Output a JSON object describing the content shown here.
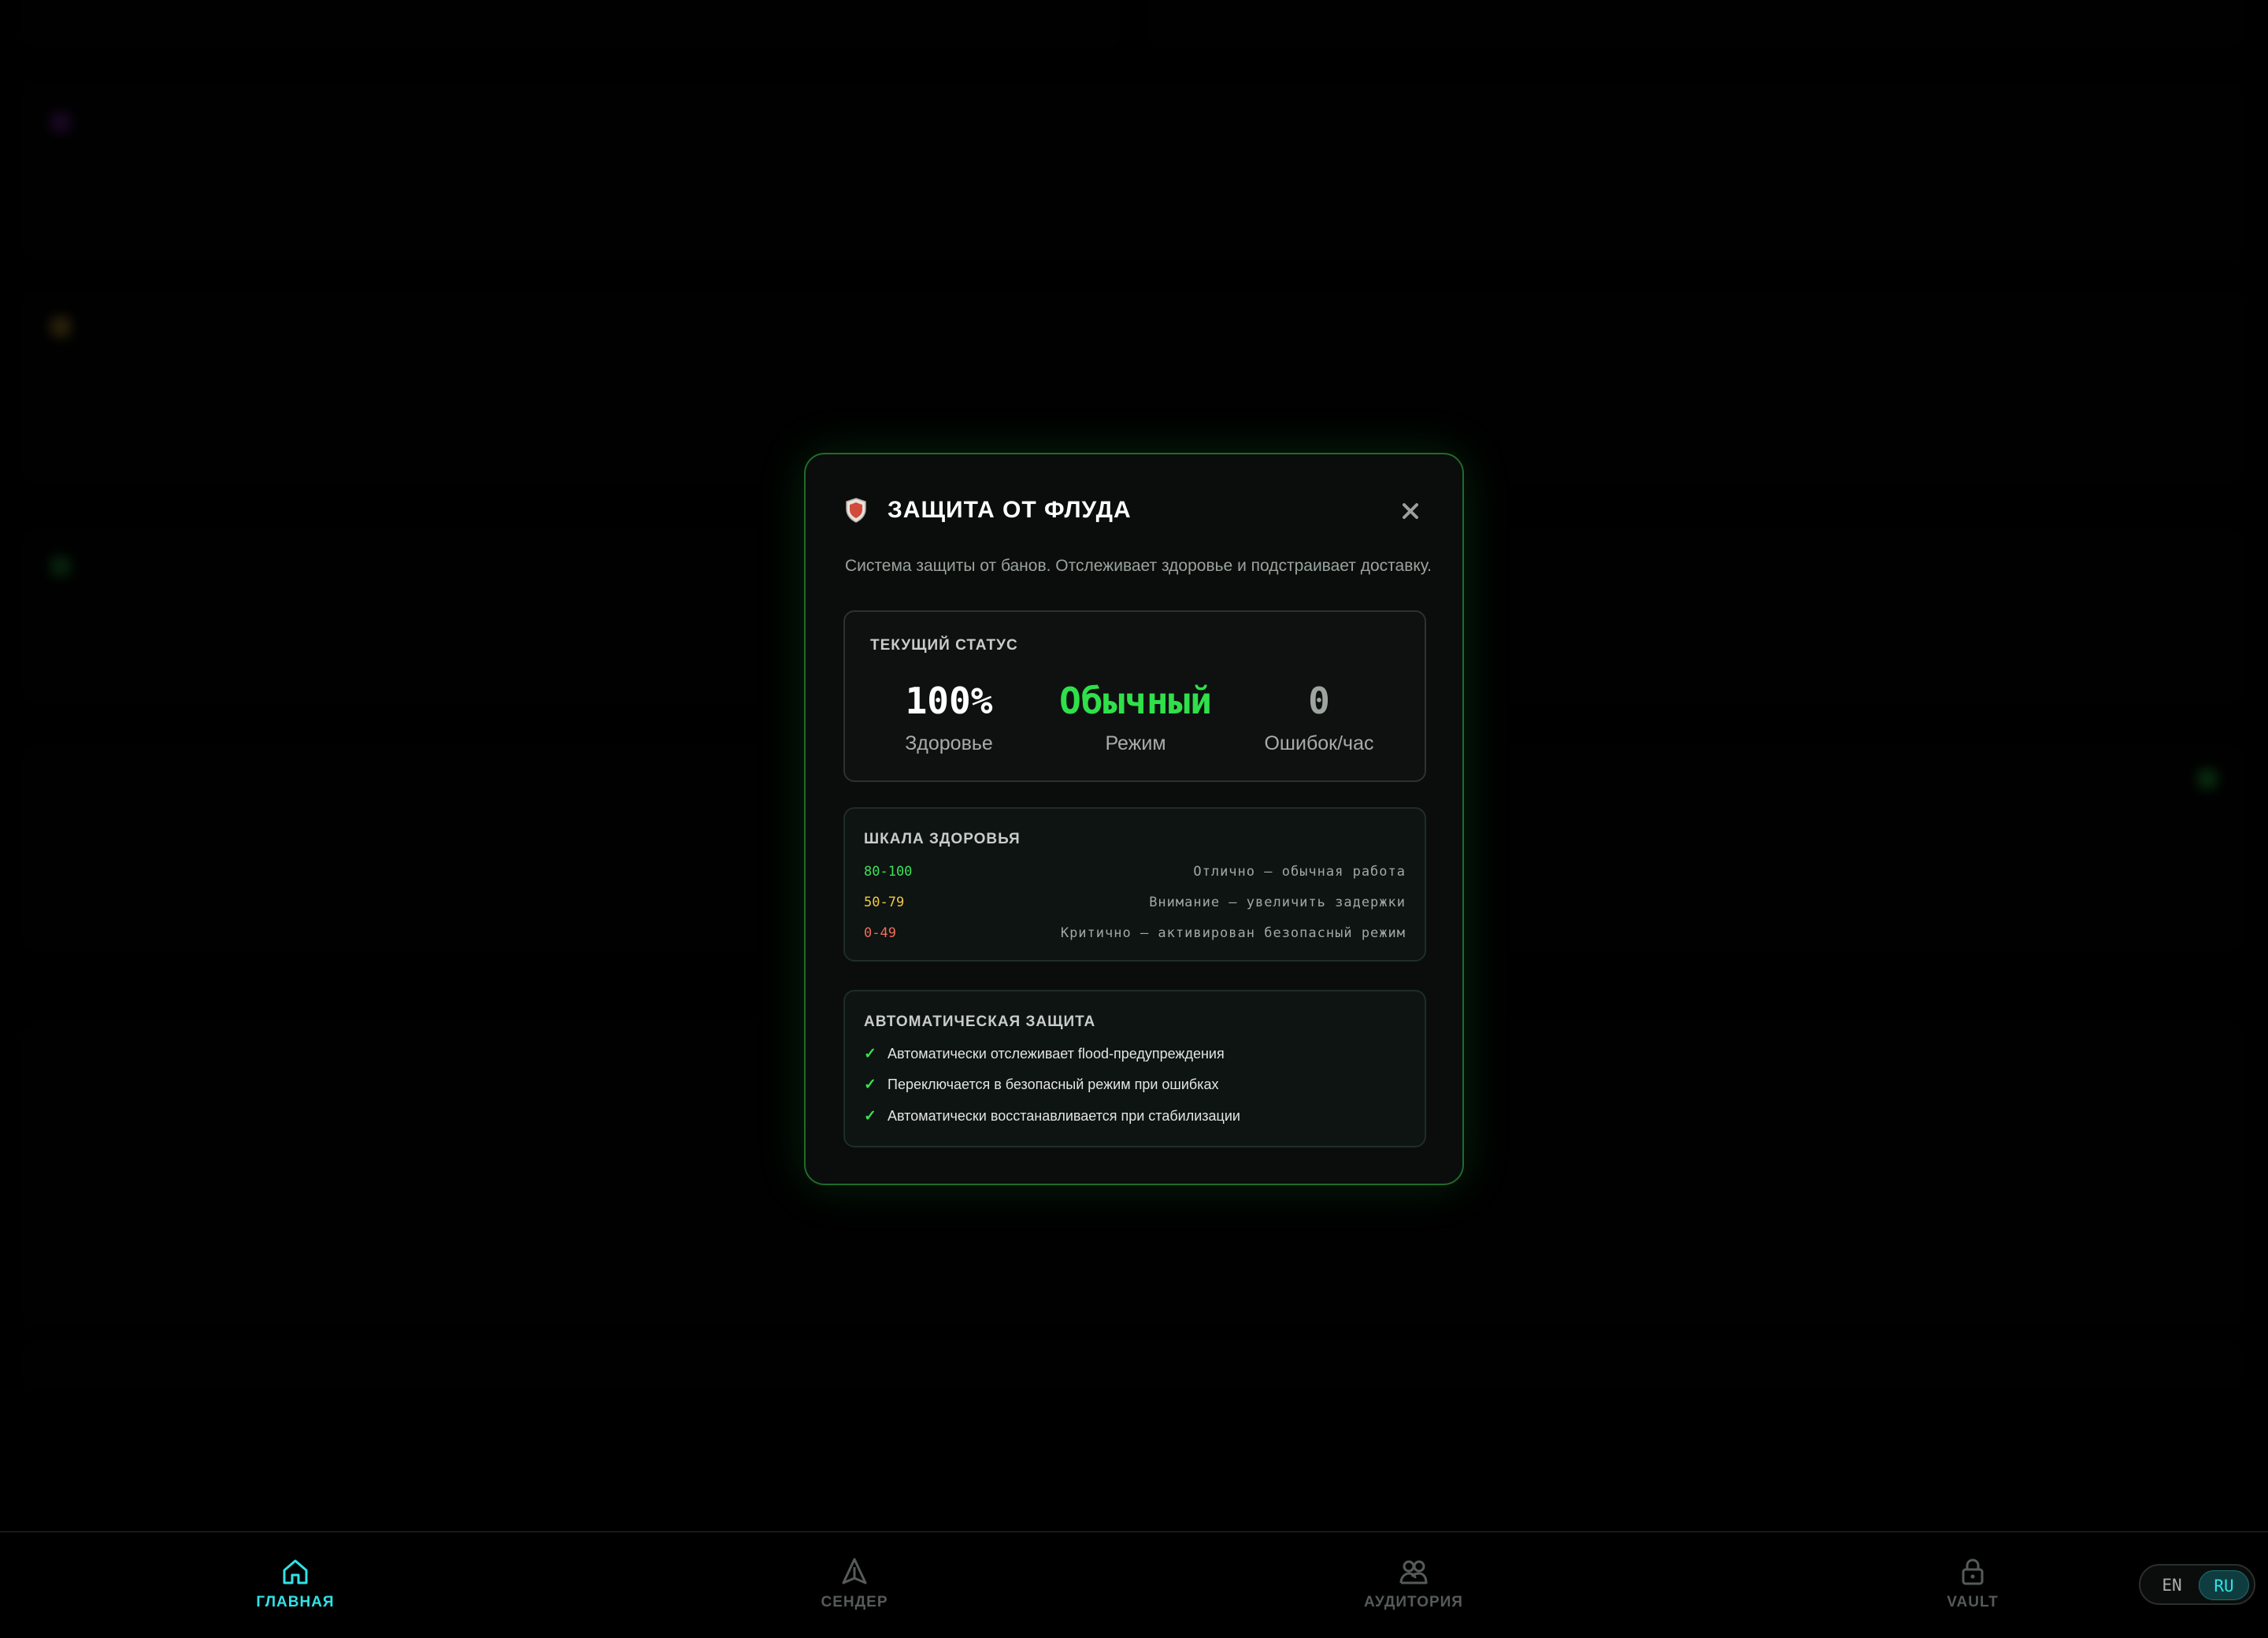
{
  "modal": {
    "title": "ЗАЩИТА ОТ ФЛУДА",
    "subtitle": "Система защиты от банов. Отслеживает здоровье и подстраивает доставку.",
    "status": {
      "label": "ТЕКУЩИЙ СТАТУС",
      "health_value": "100%",
      "health_label": "Здоровье",
      "mode_value": "Обычный",
      "mode_label": "Режим",
      "errors_value": "0",
      "errors_label": "Ошибок/час"
    },
    "scale": {
      "label": "ШКАЛА ЗДОРОВЬЯ",
      "rows": [
        {
          "range": "80-100",
          "desc": "Отлично — обычная работа",
          "color": "#3fe05a"
        },
        {
          "range": "50-79",
          "desc": "Внимание — увеличить задержки",
          "color": "#f2c744"
        },
        {
          "range": "0-49",
          "desc": "Критично — активирован безопасный режим",
          "color": "#f06a5c"
        }
      ]
    },
    "auto": {
      "label": "АВТОМАТИЧЕСКАЯ ЗАЩИТА",
      "check_mark": "✓",
      "items": [
        "Автоматически отслеживает flood-предупреждения",
        "Переключается в безопасный режим при ошибках",
        "Автоматически восстанавливается при стабилизации"
      ]
    }
  },
  "nav": {
    "items": [
      {
        "label": "ГЛАВНАЯ",
        "icon": "home-icon",
        "active": true
      },
      {
        "label": "СЕНДЕР",
        "icon": "send-icon",
        "active": false
      },
      {
        "label": "АУДИТОРИЯ",
        "icon": "users-icon",
        "active": false
      },
      {
        "label": "VAULT",
        "icon": "lock-icon",
        "active": false
      }
    ]
  },
  "lang": {
    "en": "EN",
    "ru": "RU",
    "selected": "RU"
  },
  "colors": {
    "accent_green": "#39e04e",
    "accent_cyan": "#2ee3e8",
    "modal_border": "#1f6b2a"
  }
}
